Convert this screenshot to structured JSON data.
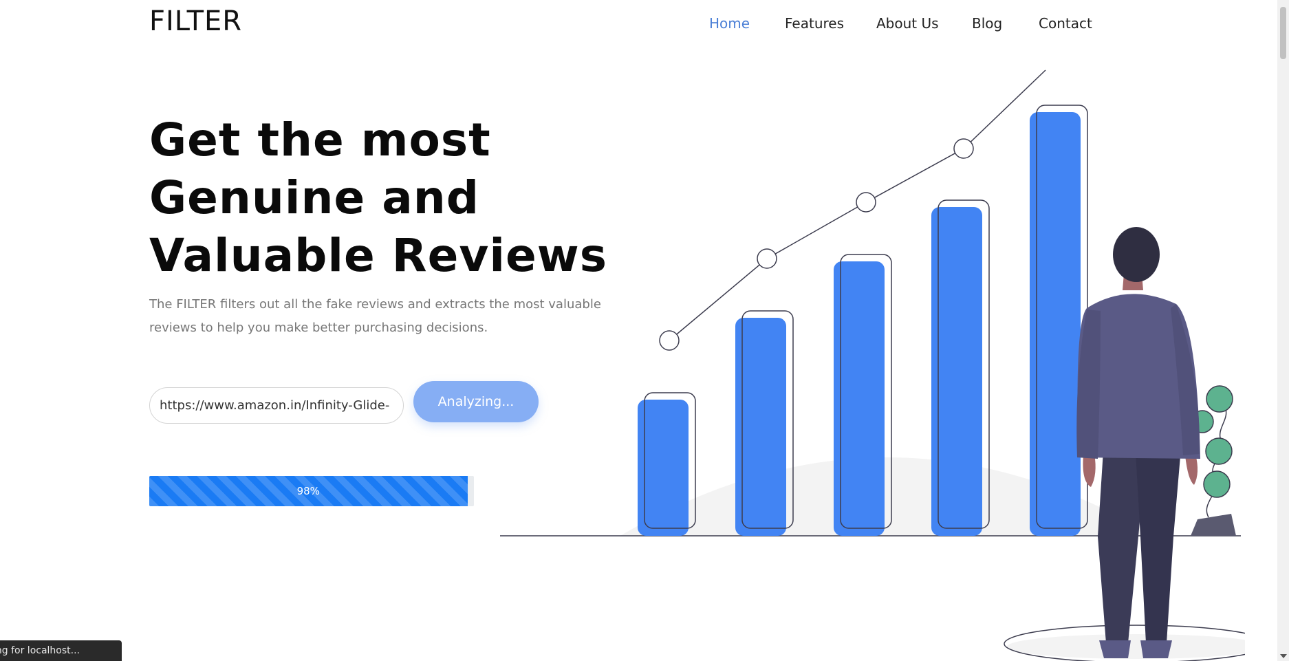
{
  "brand": {
    "logo": "FILTER"
  },
  "nav": {
    "items": [
      {
        "label": "Home",
        "active": true
      },
      {
        "label": "Features",
        "active": false
      },
      {
        "label": "About Us",
        "active": false
      },
      {
        "label": "Blog",
        "active": false
      },
      {
        "label": "Contact",
        "active": false
      }
    ]
  },
  "hero": {
    "headline": [
      "Get the most",
      "Genuine and",
      "Valuable Reviews"
    ],
    "subtitle": "The FILTER filters out all the fake reviews and extracts the most valuable reviews to help you make better purchasing decisions.",
    "url_value": "https://www.amazon.in/Infinity-Glide-",
    "button_label": "Analyzing...",
    "progress_percent": 98,
    "progress_label": "98%"
  },
  "status_bar": {
    "text": "Waiting for localhost..."
  },
  "colors": {
    "accent": "#4a7fd6",
    "bar": "#4284f3",
    "button": "#86aef4",
    "progress": "#1a7bf4",
    "suit": "#5a5a86",
    "leaf": "#5db28f"
  },
  "icons": {
    "illustration": "growth-chart-illustration",
    "person": "businessman-figure",
    "plant": "potted-plant"
  }
}
